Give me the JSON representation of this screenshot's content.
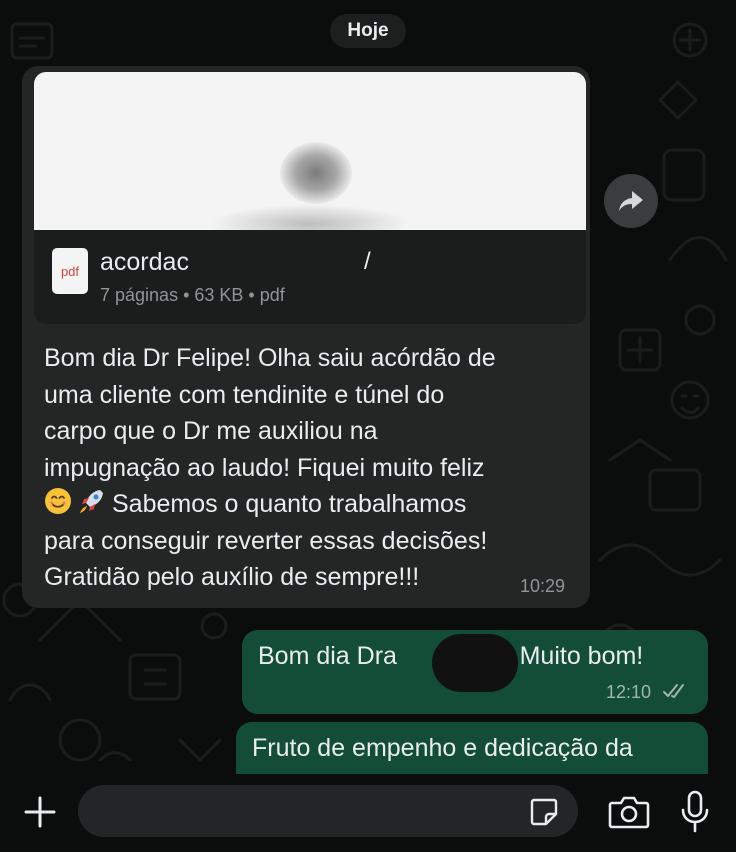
{
  "chat": {
    "date_label": "Hoje",
    "incoming": {
      "file": {
        "type_label": "pdf",
        "name_visible": "acordac",
        "name_tail": "/",
        "meta": "7 páginas • 63 KB • pdf"
      },
      "lines": [
        "Bom dia Dr Felipe! Olha saiu acórdão de",
        "uma cliente com tendinite e túnel do",
        "carpo que o Dr me auxiliou na",
        "impugnação ao laudo! Fiquei muito feliz",
        "Sabemos o quanto trabalhamos",
        "para conseguir reverter essas decisões!",
        "Gratidão pelo auxílio de sempre!!!"
      ],
      "emojis": [
        "smiling-face-icon",
        "rocket-icon"
      ],
      "time": "10:29"
    },
    "outgoing": [
      {
        "text_start": "Bom dia Dra",
        "text_end": "n!!!! Muito bom!",
        "time": "12:10",
        "status": "read-double-check"
      },
      {
        "text": "Fruto de empenho e dedicação da"
      }
    ]
  },
  "composer": {
    "placeholder": ""
  },
  "colors": {
    "background": "#0b0c0c",
    "incoming_bubble": "#242626",
    "outgoing_bubble": "#134d37",
    "meta_text": "#8d9598",
    "read_ticks": "#9fb7ad"
  }
}
